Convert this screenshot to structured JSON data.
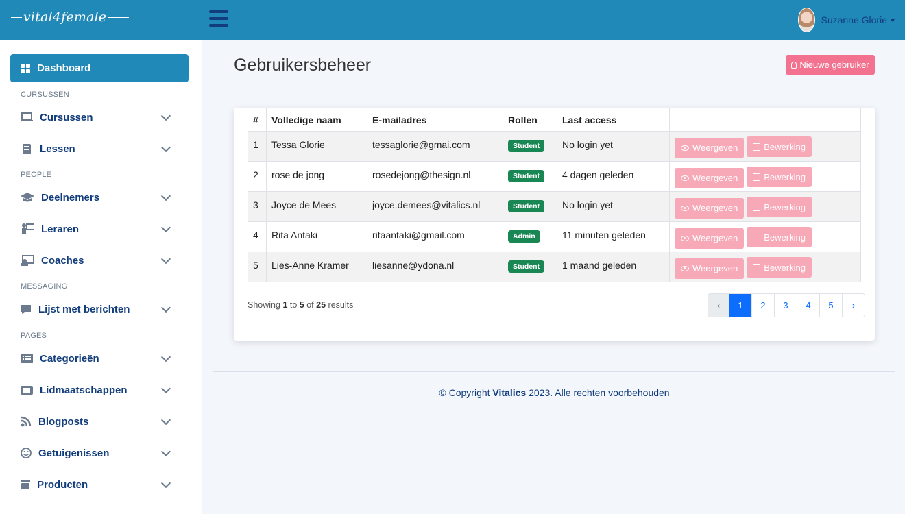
{
  "header": {
    "logo_left": "vital",
    "logo_mid": "4",
    "logo_right": "female",
    "user_name": "Suzanne Glorie"
  },
  "sidebar": {
    "dashboard": "Dashboard",
    "sections": [
      "CURSUSSEN",
      "PEOPLE",
      "MESSAGING",
      "PAGES"
    ],
    "items": [
      {
        "label": "Cursussen",
        "icon": "laptop-icon"
      },
      {
        "label": "Lessen",
        "icon": "book-icon"
      },
      {
        "label": "Deelnemers",
        "icon": "graduation-cap-icon"
      },
      {
        "label": "Leraren",
        "icon": "teacher-icon"
      },
      {
        "label": "Coaches",
        "icon": "coach-icon"
      },
      {
        "label": "Lijst met berichten",
        "icon": "message-icon"
      },
      {
        "label": "Categorieën",
        "icon": "list-icon"
      },
      {
        "label": "Lidmaatschappen",
        "icon": "ticket-icon"
      },
      {
        "label": "Blogposts",
        "icon": "rss-icon"
      },
      {
        "label": "Getuigenissen",
        "icon": "smile-icon"
      },
      {
        "label": "Producten",
        "icon": "box-icon"
      }
    ]
  },
  "main": {
    "title": "Gebruikersbeheer",
    "new_user_label": "Nieuwe gebruiker",
    "columns": [
      "#",
      "Volledige naam",
      "E-mailadres",
      "Rollen",
      "Last access",
      ""
    ],
    "rows": [
      {
        "num": "1",
        "name": "Tessa Glorie",
        "email": "tessaglorie@gmai.com",
        "role": "Student",
        "access": "No login yet"
      },
      {
        "num": "2",
        "name": "rose de jong",
        "email": "rosedejong@thesign.nl",
        "role": "Student",
        "access": "4 dagen geleden"
      },
      {
        "num": "3",
        "name": "Joyce de Mees",
        "email": "joyce.demees@vitalics.nl",
        "role": "Student",
        "access": "No login yet"
      },
      {
        "num": "4",
        "name": "Rita Antaki",
        "email": "ritaantaki@gmail.com",
        "role": "Admin",
        "access": "11 minuten geleden"
      },
      {
        "num": "5",
        "name": "Lies-Anne Kramer",
        "email": "liesanne@ydona.nl",
        "role": "Student",
        "access": "1 maand geleden"
      }
    ],
    "view_label": "Weergeven",
    "edit_label": "Bewerking",
    "showing": {
      "prefix": "Showing",
      "from": "1",
      "to_word": "to",
      "to": "5",
      "of_word": "of",
      "total": "25",
      "suffix": "results"
    },
    "pager": {
      "prev": "‹",
      "pages": [
        "1",
        "2",
        "3",
        "4",
        "5"
      ],
      "next": "›",
      "active_page": "1"
    }
  },
  "footer": {
    "prefix": "© Copyright",
    "brand": "Vitalics",
    "suffix": "2023. Alle rechten voorbehouden"
  },
  "colors": {
    "topbar": "#2089b8",
    "navy": "#123d7c",
    "pink": "#f2728f",
    "pink_light": "#f7a9b8",
    "badge_green": "#198754",
    "pager_blue": "#0d6efd"
  }
}
